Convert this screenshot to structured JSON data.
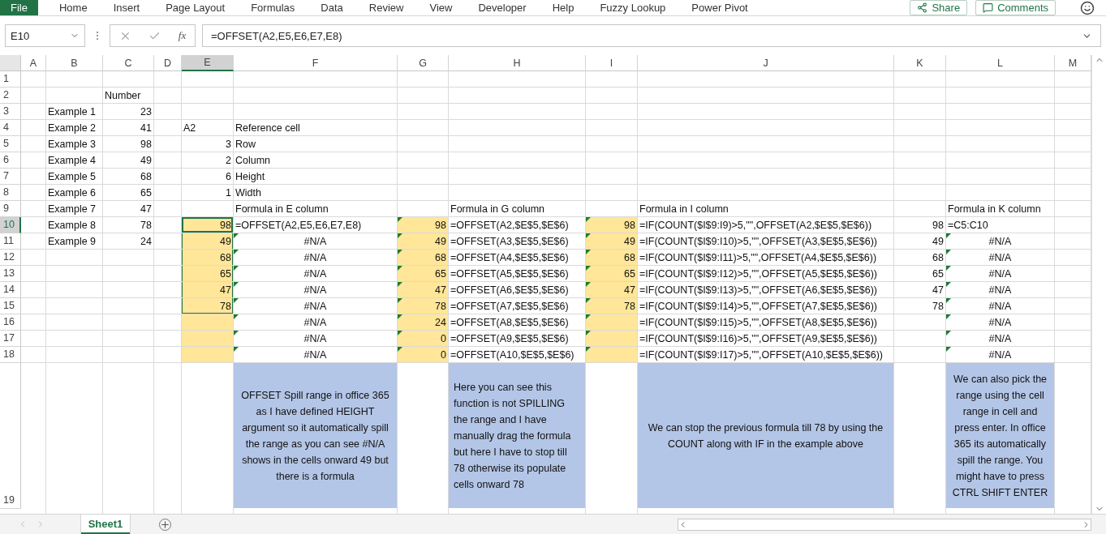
{
  "ribbon_tabs": [
    {
      "label": "File",
      "selected": true
    },
    {
      "label": "Home",
      "selected": false
    },
    {
      "label": "Insert",
      "selected": false
    },
    {
      "label": "Page Layout",
      "selected": false
    },
    {
      "label": "Formulas",
      "selected": false
    },
    {
      "label": "Data",
      "selected": false
    },
    {
      "label": "Review",
      "selected": false
    },
    {
      "label": "View",
      "selected": false
    },
    {
      "label": "Developer",
      "selected": false
    },
    {
      "label": "Help",
      "selected": false
    },
    {
      "label": "Fuzzy Lookup",
      "selected": false
    },
    {
      "label": "Power Pivot",
      "selected": false
    }
  ],
  "ribbon_buttons": [
    {
      "label": "Share",
      "kind": "share"
    },
    {
      "label": "Comments",
      "kind": "comments"
    }
  ],
  "formula_bar": {
    "name_box": "E10",
    "function_label": "fx",
    "formula": "=OFFSET(A2,E5,E6,E7,E8)"
  },
  "columns": [
    {
      "label": "A",
      "selected": false
    },
    {
      "label": "B",
      "selected": false
    },
    {
      "label": "C",
      "selected": false
    },
    {
      "label": "D",
      "selected": false
    },
    {
      "label": "E",
      "selected": true
    },
    {
      "label": "F",
      "selected": false
    },
    {
      "label": "G",
      "selected": false
    },
    {
      "label": "H",
      "selected": false
    },
    {
      "label": "I",
      "selected": false
    },
    {
      "label": "J",
      "selected": false
    },
    {
      "label": "K",
      "selected": false
    },
    {
      "label": "L",
      "selected": false
    },
    {
      "label": "M",
      "selected": false
    }
  ],
  "rows": [
    {
      "number": "1",
      "selected": false
    },
    {
      "number": "2",
      "selected": false,
      "cells": [
        {},
        {},
        {
          "text": "Number",
          "kind": "text"
        }
      ]
    },
    {
      "number": "3",
      "selected": false,
      "cells": [
        {},
        {
          "text": "Example 1",
          "kind": "text"
        },
        {
          "text": "23",
          "kind": "number"
        }
      ]
    },
    {
      "number": "4",
      "selected": false,
      "cells": [
        {},
        {
          "text": "Example 2",
          "kind": "text"
        },
        {
          "text": "41",
          "kind": "number"
        },
        {},
        {
          "text": "A2",
          "kind": "text"
        },
        {
          "text": "Reference cell",
          "kind": "text"
        }
      ]
    },
    {
      "number": "5",
      "selected": false,
      "cells": [
        {},
        {
          "text": "Example 3",
          "kind": "text"
        },
        {
          "text": "98",
          "kind": "number"
        },
        {},
        {
          "text": "3",
          "kind": "number"
        },
        {
          "text": "Row",
          "kind": "text"
        }
      ]
    },
    {
      "number": "6",
      "selected": false,
      "cells": [
        {},
        {
          "text": "Example 4",
          "kind": "text"
        },
        {
          "text": "49",
          "kind": "number"
        },
        {},
        {
          "text": "2",
          "kind": "number"
        },
        {
          "text": "Column",
          "kind": "text"
        }
      ]
    },
    {
      "number": "7",
      "selected": false,
      "cells": [
        {},
        {
          "text": "Example 5",
          "kind": "text"
        },
        {
          "text": "68",
          "kind": "number"
        },
        {},
        {
          "text": "6",
          "kind": "number"
        },
        {
          "text": "Height",
          "kind": "text"
        }
      ]
    },
    {
      "number": "8",
      "selected": false,
      "cells": [
        {},
        {
          "text": "Example 6",
          "kind": "text"
        },
        {
          "text": "65",
          "kind": "number"
        },
        {},
        {
          "text": "1",
          "kind": "number"
        },
        {
          "text": "Width",
          "kind": "text"
        }
      ]
    },
    {
      "number": "9",
      "selected": false,
      "cells": [
        {},
        {
          "text": "Example 7",
          "kind": "text"
        },
        {
          "text": "47",
          "kind": "number"
        },
        {},
        {},
        {
          "text": "Formula in E column",
          "kind": "text"
        },
        {},
        {
          "text": "Formula in G column",
          "kind": "text"
        },
        {},
        {
          "text": "Formula in I column",
          "kind": "text"
        },
        {},
        {
          "text": "Formula in K column",
          "kind": "text"
        }
      ]
    },
    {
      "number": "10",
      "selected": true,
      "cells": [
        {},
        {
          "text": "Example 8",
          "kind": "text"
        },
        {
          "text": "78",
          "kind": "number"
        },
        {},
        {
          "text": "98",
          "kind": "number",
          "color": "#ffe699",
          "selected": true,
          "active": true
        },
        {
          "text": "=OFFSET(A2,E5,E6,E7,E8)",
          "kind": "text"
        },
        {
          "text": "98",
          "kind": "number",
          "color": "#ffe699",
          "flag": true
        },
        {
          "text": "=OFFSET(A2,$E$5,$E$6)",
          "kind": "text"
        },
        {
          "text": "98",
          "kind": "number",
          "color": "#ffe699",
          "flag": true
        },
        {
          "text": "=IF(COUNT($I$9:I9)>5,\"\",OFFSET(A2,$E$5,$E$6))",
          "kind": "text"
        },
        {
          "text": "98",
          "kind": "number"
        },
        {
          "text": "=C5:C10",
          "kind": "text"
        }
      ]
    },
    {
      "number": "11",
      "selected": false,
      "cells": [
        {},
        {
          "text": "Example 9",
          "kind": "text"
        },
        {
          "text": "24",
          "kind": "number"
        },
        {},
        {
          "text": "49",
          "kind": "number",
          "color": "#ffe699",
          "selected": true
        },
        {
          "text": "#N/A",
          "kind": "center",
          "flag": true
        },
        {
          "text": "49",
          "kind": "number",
          "color": "#ffe699",
          "flag": true
        },
        {
          "text": "=OFFSET(A3,$E$5,$E$6)",
          "kind": "text"
        },
        {
          "text": "49",
          "kind": "number",
          "color": "#ffe699",
          "flag": true
        },
        {
          "text": "=IF(COUNT($I$9:I10)>5,\"\",OFFSET(A3,$E$5,$E$6))",
          "kind": "text"
        },
        {
          "text": "49",
          "kind": "number"
        },
        {
          "text": "#N/A",
          "kind": "center",
          "flag": true
        }
      ]
    },
    {
      "number": "12",
      "selected": false,
      "cells": [
        {},
        {},
        {},
        {},
        {
          "text": "68",
          "kind": "number",
          "color": "#ffe699",
          "selected": true
        },
        {
          "text": "#N/A",
          "kind": "center",
          "flag": true
        },
        {
          "text": "68",
          "kind": "number",
          "color": "#ffe699",
          "flag": true
        },
        {
          "text": "=OFFSET(A4,$E$5,$E$6)",
          "kind": "text"
        },
        {
          "text": "68",
          "kind": "number",
          "color": "#ffe699",
          "flag": true
        },
        {
          "text": "=IF(COUNT($I$9:I11)>5,\"\",OFFSET(A4,$E$5,$E$6))",
          "kind": "text"
        },
        {
          "text": "68",
          "kind": "number"
        },
        {
          "text": "#N/A",
          "kind": "center",
          "flag": true
        }
      ]
    },
    {
      "number": "13",
      "selected": false,
      "cells": [
        {},
        {},
        {},
        {},
        {
          "text": "65",
          "kind": "number",
          "color": "#ffe699",
          "selected": true
        },
        {
          "text": "#N/A",
          "kind": "center",
          "flag": true
        },
        {
          "text": "65",
          "kind": "number",
          "color": "#ffe699",
          "flag": true
        },
        {
          "text": "=OFFSET(A5,$E$5,$E$6)",
          "kind": "text"
        },
        {
          "text": "65",
          "kind": "number",
          "color": "#ffe699",
          "flag": true
        },
        {
          "text": "=IF(COUNT($I$9:I12)>5,\"\",OFFSET(A5,$E$5,$E$6))",
          "kind": "text"
        },
        {
          "text": "65",
          "kind": "number"
        },
        {
          "text": "#N/A",
          "kind": "center",
          "flag": true
        }
      ]
    },
    {
      "number": "14",
      "selected": false,
      "cells": [
        {},
        {},
        {},
        {},
        {
          "text": "47",
          "kind": "number",
          "color": "#ffe699",
          "selected": true
        },
        {
          "text": "#N/A",
          "kind": "center",
          "flag": true
        },
        {
          "text": "47",
          "kind": "number",
          "color": "#ffe699",
          "flag": true
        },
        {
          "text": "=OFFSET(A6,$E$5,$E$6)",
          "kind": "text"
        },
        {
          "text": "47",
          "kind": "number",
          "color": "#ffe699",
          "flag": true
        },
        {
          "text": "=IF(COUNT($I$9:I13)>5,\"\",OFFSET(A6,$E$5,$E$6))",
          "kind": "text"
        },
        {
          "text": "47",
          "kind": "number"
        },
        {
          "text": "#N/A",
          "kind": "center",
          "flag": true
        }
      ]
    },
    {
      "number": "15",
      "selected": false,
      "cells": [
        {},
        {},
        {},
        {},
        {
          "text": "78",
          "kind": "number",
          "color": "#ffe699",
          "selected": true
        },
        {
          "text": "#N/A",
          "kind": "center",
          "flag": true
        },
        {
          "text": "78",
          "kind": "number",
          "color": "#ffe699",
          "flag": true
        },
        {
          "text": "=OFFSET(A7,$E$5,$E$6)",
          "kind": "text"
        },
        {
          "text": "78",
          "kind": "number",
          "color": "#ffe699",
          "flag": true
        },
        {
          "text": "=IF(COUNT($I$9:I14)>5,\"\",OFFSET(A7,$E$5,$E$6))",
          "kind": "text"
        },
        {
          "text": "78",
          "kind": "number"
        },
        {
          "text": "#N/A",
          "kind": "center",
          "flag": true
        }
      ]
    },
    {
      "number": "16",
      "selected": false,
      "cells": [
        {},
        {},
        {},
        {},
        {
          "color": "#ffe699"
        },
        {
          "text": "#N/A",
          "kind": "center",
          "flag": true
        },
        {
          "text": "24",
          "kind": "number",
          "color": "#ffe699",
          "flag": true
        },
        {
          "text": "=OFFSET(A8,$E$5,$E$6)",
          "kind": "text"
        },
        {
          "color": "#ffe699",
          "flag": true
        },
        {
          "text": "=IF(COUNT($I$9:I15)>5,\"\",OFFSET(A8,$E$5,$E$6))",
          "kind": "text"
        },
        {},
        {
          "text": "#N/A",
          "kind": "center",
          "flag": true
        }
      ]
    },
    {
      "number": "17",
      "selected": false,
      "cells": [
        {},
        {},
        {},
        {},
        {
          "color": "#ffe699"
        },
        {
          "text": "#N/A",
          "kind": "center",
          "flag": true
        },
        {
          "text": "0",
          "kind": "number",
          "color": "#ffe699",
          "flag": true
        },
        {
          "text": "=OFFSET(A9,$E$5,$E$6)",
          "kind": "text"
        },
        {
          "color": "#ffe699",
          "flag": true
        },
        {
          "text": "=IF(COUNT($I$9:I16)>5,\"\",OFFSET(A9,$E$5,$E$6))",
          "kind": "text"
        },
        {},
        {
          "text": "#N/A",
          "kind": "center",
          "flag": true
        }
      ]
    },
    {
      "number": "18",
      "selected": false,
      "cells": [
        {},
        {},
        {},
        {},
        {
          "color": "#ffe699"
        },
        {
          "text": "#N/A",
          "kind": "center",
          "flag": true
        },
        {
          "text": "0",
          "kind": "number",
          "color": "#ffe699",
          "flag": true
        },
        {
          "text": "=OFFSET(A10,$E$5,$E$6)",
          "kind": "text"
        },
        {
          "color": "#ffe699",
          "flag": true
        },
        {
          "text": "=IF(COUNT($I$9:I17)>5,\"\",OFFSET(A10,$E$5,$E$6))",
          "kind": "text"
        },
        {},
        {
          "text": "#N/A",
          "kind": "center",
          "flag": true
        }
      ]
    },
    {
      "number": "19",
      "selected": false,
      "cells": [
        {},
        {},
        {},
        {},
        {},
        {
          "text": "OFFSET Spill range in office 365 as I have defined HEIGHT argument so it automatically spill the range as you can see #N/A shows in the cells onward 49 but there is a formula",
          "kind": "note",
          "color": "#b4c6e7"
        },
        {},
        {
          "text": "Here you can see this function is not SPILLING the range and I have manually drag the formula but here I have to stop till 78 otherwise its populate cells onward 78",
          "kind": "note_left",
          "color": "#b4c6e7"
        },
        {},
        {
          "text": "We can stop the previous formula till 78 by using the COUNT along with IF in the example above",
          "kind": "note",
          "color": "#b4c6e7"
        },
        {},
        {
          "text": "We can also pick the range using the cell range in cell and press enter. In office 365 its automatically spill the range. You might have to press CTRL SHIFT ENTER",
          "kind": "note",
          "color": "#b4c6e7"
        }
      ]
    }
  ],
  "sheet_tabs": [
    {
      "label": "Sheet1",
      "selected": true
    }
  ]
}
